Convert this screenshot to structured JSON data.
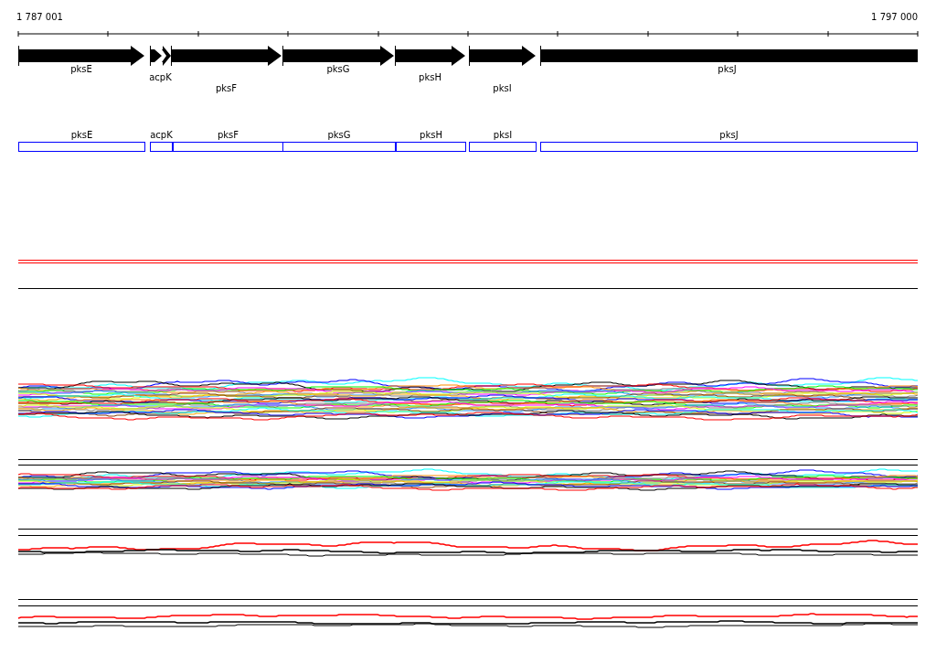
{
  "ruler": {
    "start": "1 787 001",
    "end": "1 797 000"
  },
  "genes": [
    {
      "name": "pksE"
    },
    {
      "name": "acpK"
    },
    {
      "name": "pksF"
    },
    {
      "name": "pksG"
    },
    {
      "name": "pksH"
    },
    {
      "name": "pksI"
    },
    {
      "name": "pksJ"
    }
  ],
  "cds": [
    {
      "name": "pksE"
    },
    {
      "name": "acpK"
    },
    {
      "name": "pksF"
    },
    {
      "name": "pksG"
    },
    {
      "name": "pksH"
    },
    {
      "name": "pksI"
    },
    {
      "name": "pksJ"
    }
  ]
}
